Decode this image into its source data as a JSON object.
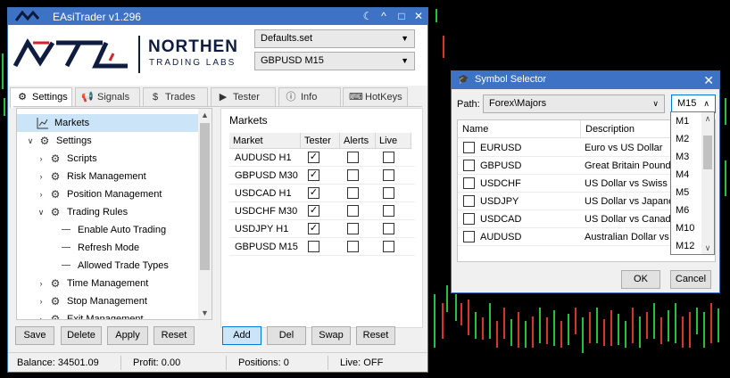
{
  "main_window": {
    "title": "EAsiTrader v1.296",
    "controls": {
      "theme": "☾",
      "collapse": "^",
      "maximize": "□",
      "close": "✕"
    }
  },
  "logo": {
    "mark": "NTL",
    "line1": "NORTHEN",
    "line2": "TRADING LABS"
  },
  "header": {
    "settings_file": "Defaults.set",
    "symbol_timeframe": "GBPUSD M15"
  },
  "tabs": [
    {
      "label": "Settings",
      "icon": "gear-icon",
      "active": true
    },
    {
      "label": "Signals",
      "icon": "megaphone-icon",
      "active": false
    },
    {
      "label": "Trades",
      "icon": "dollar-icon",
      "active": false
    },
    {
      "label": "Tester",
      "icon": "play-icon",
      "active": false
    },
    {
      "label": "Info",
      "icon": "info-icon",
      "active": false
    },
    {
      "label": "HotKeys",
      "icon": "keyboard-icon",
      "active": false
    }
  ],
  "tree": {
    "items": [
      {
        "label": "Markets",
        "selected": true,
        "expander": "",
        "icon": "chart-icon"
      },
      {
        "label": "Settings",
        "expander": "∨",
        "icon": "gear-icon"
      },
      {
        "label": "Scripts",
        "expander": "›",
        "icon": "gear-icon"
      },
      {
        "label": "Risk Management",
        "expander": "›",
        "icon": "gear-icon"
      },
      {
        "label": "Position Management",
        "expander": "›",
        "icon": "gear-icon"
      },
      {
        "label": "Trading Rules",
        "expander": "∨",
        "icon": "gear-icon"
      },
      {
        "label": "Enable Auto Trading",
        "expander": "",
        "icon": "dash"
      },
      {
        "label": "Refresh Mode",
        "expander": "",
        "icon": "dash"
      },
      {
        "label": "Allowed Trade Types",
        "expander": "",
        "icon": "dash"
      },
      {
        "label": "Time Management",
        "expander": "›",
        "icon": "gear-icon"
      },
      {
        "label": "Stop Management",
        "expander": "›",
        "icon": "gear-icon"
      },
      {
        "label": "Exit Management",
        "expander": "›",
        "icon": "gear-icon"
      }
    ]
  },
  "left_buttons": {
    "save": "Save",
    "delete": "Delete",
    "apply": "Apply",
    "reset": "Reset"
  },
  "markets": {
    "title": "Markets",
    "columns": [
      "Market",
      "Tester",
      "Alerts",
      "Live"
    ],
    "rows": [
      {
        "market": "AUDUSD H1",
        "tester": true,
        "alerts": false,
        "live": false
      },
      {
        "market": "GBPUSD M30",
        "tester": true,
        "alerts": false,
        "live": false
      },
      {
        "market": "USDCAD H1",
        "tester": true,
        "alerts": false,
        "live": false
      },
      {
        "market": "USDCHF M30",
        "tester": true,
        "alerts": false,
        "live": false
      },
      {
        "market": "USDJPY H1",
        "tester": true,
        "alerts": false,
        "live": false
      },
      {
        "market": "GBPUSD M15",
        "tester": false,
        "alerts": false,
        "live": false
      }
    ]
  },
  "market_buttons": {
    "add": "Add",
    "del": "Del",
    "swap": "Swap",
    "reset": "Reset"
  },
  "status": {
    "balance": "Balance: 34501.09",
    "profit": "Profit: 0.00",
    "positions": "Positions: 0",
    "live": "Live: OFF"
  },
  "symbol_selector": {
    "title": "Symbol Selector",
    "path_label": "Path:",
    "path_value": "Forex\\Majors",
    "timeframe_value": "M15",
    "columns": [
      "Name",
      "Description"
    ],
    "symbols": [
      {
        "name": "EURUSD",
        "description": "Euro vs US Dollar"
      },
      {
        "name": "GBPUSD",
        "description": "Great Britain Pound vs"
      },
      {
        "name": "USDCHF",
        "description": "US Dollar vs Swiss Fra"
      },
      {
        "name": "USDJPY",
        "description": "US Dollar vs Japanese"
      },
      {
        "name": "USDCAD",
        "description": "US Dollar vs Canadian"
      },
      {
        "name": "AUDUSD",
        "description": "Australian Dollar vs U"
      }
    ],
    "timeframe_options": [
      "M1",
      "M2",
      "M3",
      "M4",
      "M5",
      "M6",
      "M10",
      "M12"
    ],
    "ok": "OK",
    "cancel": "Cancel"
  },
  "colors": {
    "titlebar": "#3e72c4",
    "selection": "#cce4f7",
    "candle_up": "#22c33a",
    "candle_down": "#d8342a"
  }
}
